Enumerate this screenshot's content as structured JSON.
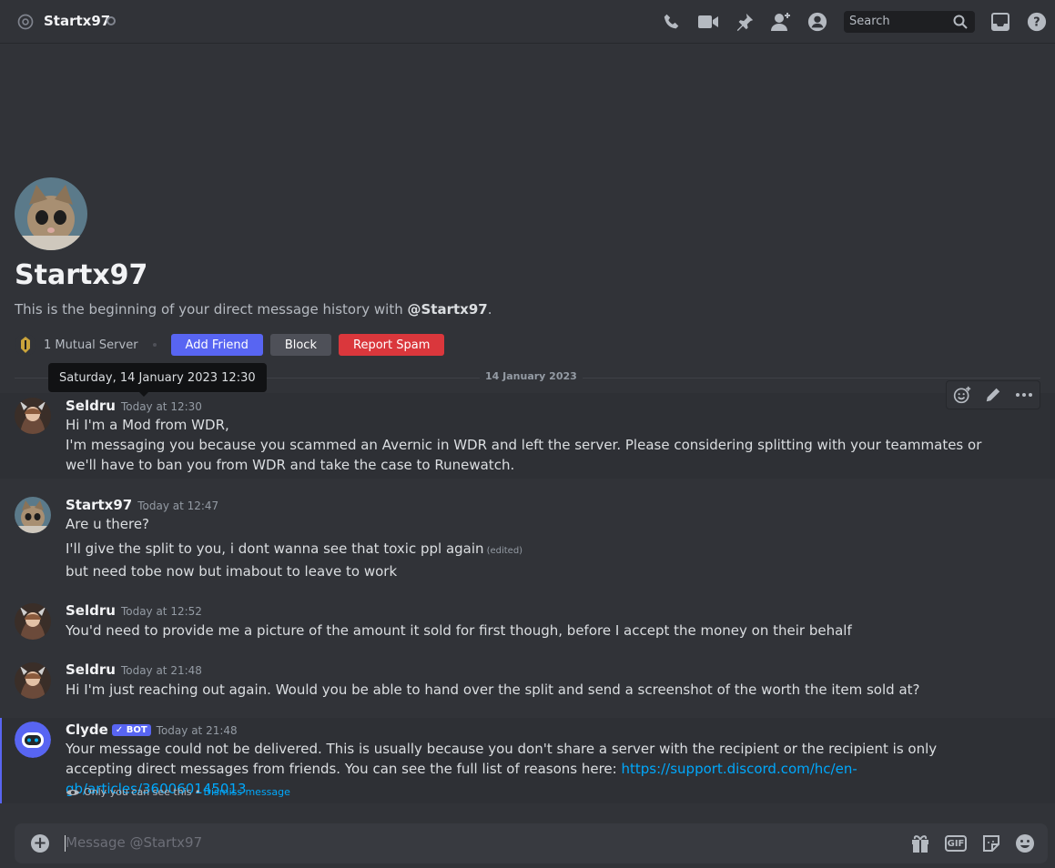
{
  "header": {
    "title": "Startx97",
    "search_placeholder": "Search"
  },
  "intro": {
    "title": "Startx97",
    "desc_prefix": "This is the beginning of your direct message history with ",
    "desc_handle": "@Startx97",
    "desc_suffix": ".",
    "mutual": "1 Mutual Server",
    "buttons": {
      "add_friend": "Add Friend",
      "block": "Block",
      "report_spam": "Report Spam"
    }
  },
  "tooltip": "Saturday, 14 January 2023 12:30",
  "divider": "14 January 2023",
  "messages": [
    {
      "author": "Seldru",
      "time": "Today at 12:30",
      "lines": [
        "Hi I'm a Mod from WDR,",
        "I'm messaging you because you scammed an Avernic in WDR and left the server. Please considering splitting with your teammates or we'll have to ban you from WDR and take the case to Runewatch."
      ]
    },
    {
      "author": "Startx97",
      "time": "Today at 12:47",
      "lines": [
        "Are u there?",
        "I'll give the split to you, i dont wanna see that toxic ppl again",
        "but need tobe now but imabout to leave to work"
      ],
      "edited": "(edited)"
    },
    {
      "author": "Seldru",
      "time": "Today at 12:52",
      "lines": [
        "You'd need to provide me a picture of the amount it sold for first though, before I accept the money on their behalf"
      ]
    },
    {
      "author": "Seldru",
      "time": "Today at 21:48",
      "lines": [
        "Hi I'm just reaching out again. Would you be able to hand over the split and send a screenshot of the worth the item sold at?"
      ]
    },
    {
      "author": "Clyde",
      "bot_tag": "BOT",
      "time": "Today at 21:48",
      "text": "Your message could not be delivered. This is usually because you don't share a server with the recipient or the recipient is only accepting direct messages from friends. You can see the full list of reasons here: ",
      "link": "https://support.discord.com/hc/en-gb/articles/360060145013",
      "only_you": "Only you can see this •",
      "dismiss": "Dismiss message"
    }
  ],
  "composer": {
    "placeholder": "Message @Startx97",
    "gif": "GIF"
  },
  "colors": {
    "background": "#313338",
    "accent": "#5865f2",
    "danger": "#da373c",
    "link": "#00a8fc"
  }
}
